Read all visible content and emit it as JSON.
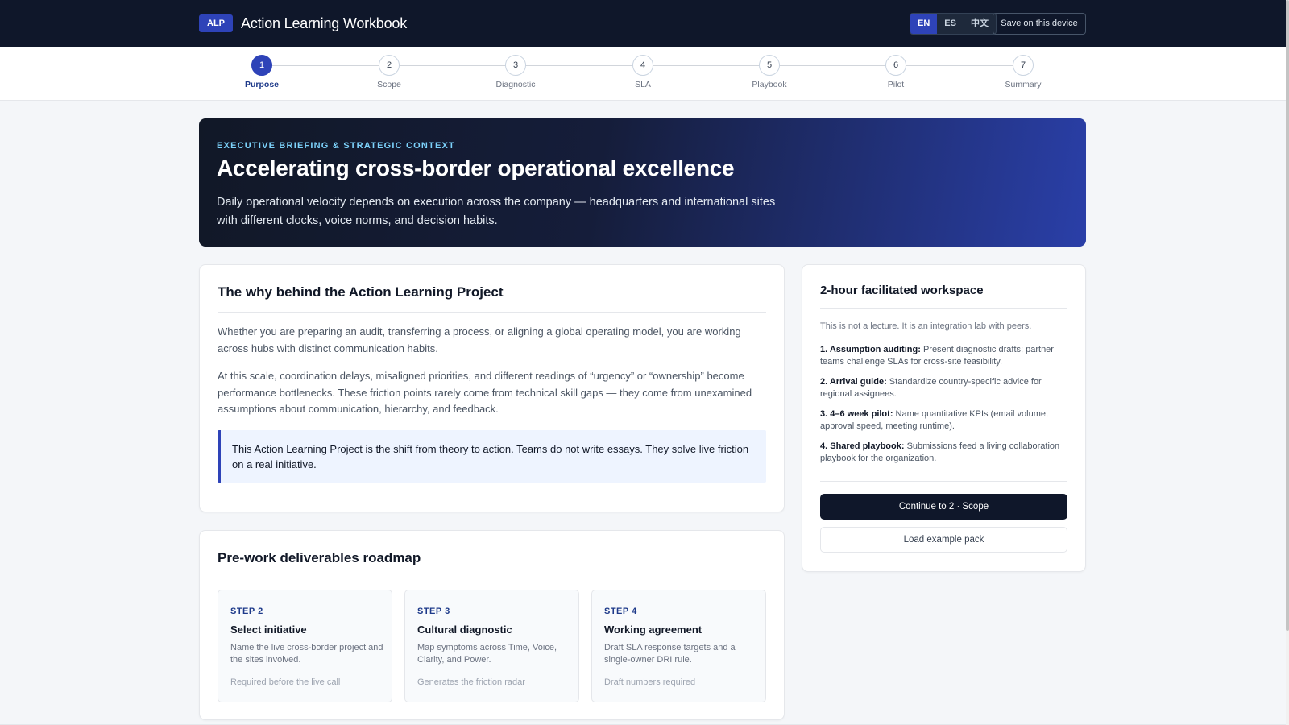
{
  "header": {
    "logo": "ALP",
    "title": "Action Learning Workbook",
    "languages": [
      "EN",
      "ES",
      "中文"
    ],
    "active_language": "EN",
    "save_label": "Save on this device"
  },
  "stepper": {
    "active_step": 1,
    "steps": [
      {
        "number": "1",
        "label": "Purpose"
      },
      {
        "number": "2",
        "label": "Scope"
      },
      {
        "number": "3",
        "label": "Diagnostic"
      },
      {
        "number": "4",
        "label": "SLA"
      },
      {
        "number": "5",
        "label": "Playbook"
      },
      {
        "number": "6",
        "label": "Pilot"
      },
      {
        "number": "7",
        "label": "Summary"
      }
    ]
  },
  "hero": {
    "eyebrow": "EXECUTIVE BRIEFING & STRATEGIC CONTEXT",
    "title": "Accelerating cross-border operational excellence",
    "description": "Daily operational velocity depends on execution across the company — headquarters and international sites with different clocks, voice norms, and decision habits."
  },
  "why": {
    "heading": "The why behind the Action Learning Project",
    "paragraphs": [
      "Whether you are preparing an audit, transferring a process, or aligning a global operating model, you are working across hubs with distinct communication habits.",
      "At this scale, coordination delays, misaligned priorities, and different readings of “urgency” or “ownership” become performance bottlenecks. These friction points rarely come from technical skill gaps — they come from unexamined assumptions about communication, hierarchy, and feedback."
    ],
    "callout": "This Action Learning Project is the shift from theory to action. Teams do not write essays. They solve live friction on a real initiative."
  },
  "workspace": {
    "heading": "2-hour facilitated workspace",
    "intro": "This is not a lecture. It is an integration lab with peers.",
    "items": [
      {
        "title": "1. Assumption auditing:",
        "text": "Present diagnostic drafts; partner teams challenge SLAs for cross-site feasibility."
      },
      {
        "title": "2. Arrival guide:",
        "text": "Standardize country-specific advice for regional assignees."
      },
      {
        "title": "3. 4–6 week pilot:",
        "text": "Name quantitative KPIs (email volume, approval speed, meeting runtime)."
      },
      {
        "title": "4. Shared playbook:",
        "text": "Submissions feed a living collaboration playbook for the organization."
      }
    ],
    "continue_label": "Continue to 2 · Scope",
    "example_label": "Load example pack"
  },
  "roadmap": {
    "heading": "Pre-work deliverables roadmap",
    "cards": [
      {
        "step": "STEP 2",
        "title": "Select initiative",
        "desc": "Name the live cross-border project and the sites involved.",
        "note": "Required before the live call"
      },
      {
        "step": "STEP 3",
        "title": "Cultural diagnostic",
        "desc": "Map symptoms across Time, Voice, Clarity, and Power.",
        "note": "Generates the friction radar"
      },
      {
        "step": "STEP 4",
        "title": "Working agreement",
        "desc": "Draft SLA response targets and a single-owner DRI rule.",
        "note": "Draft numbers required"
      }
    ]
  },
  "colors": {
    "accent": "#2e43b8",
    "topbar": "#0f172a",
    "eyebrow": "#7dd3fc"
  }
}
